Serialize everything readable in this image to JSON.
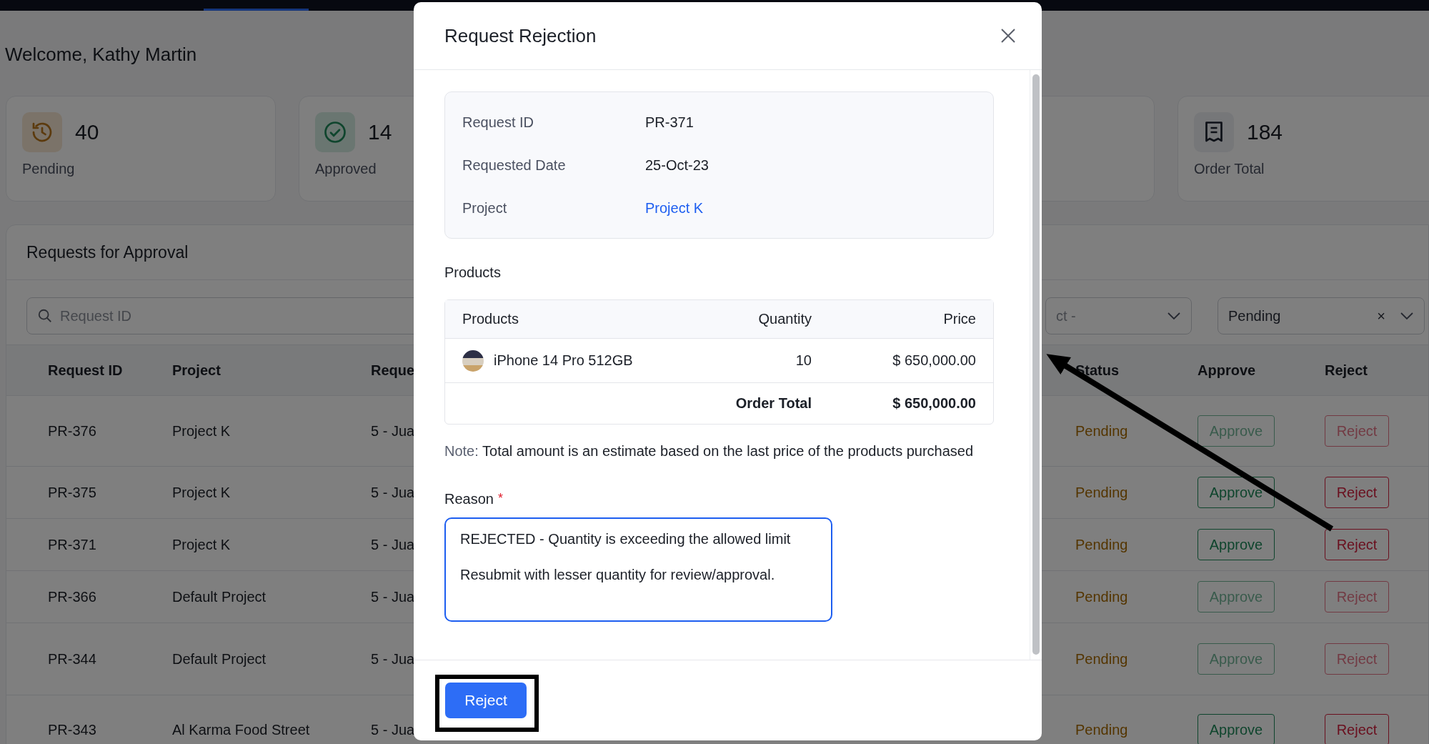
{
  "welcome": "Welcome, Kathy Martin",
  "stat_cards": [
    {
      "kind": "pending",
      "value": "40",
      "label": "Pending"
    },
    {
      "kind": "approved",
      "value": "14",
      "label": "Approved"
    },
    {
      "kind": "order_total",
      "value": "184",
      "label": "Order Total"
    }
  ],
  "approvals": {
    "title": "Requests for Approval",
    "search": {
      "placeholder": "Request ID"
    },
    "project_filter": {
      "value": "ct -"
    },
    "status_filter": {
      "value": "Pending",
      "clear": "×"
    },
    "columns": [
      "Request ID",
      "Project",
      "Reque",
      "Status",
      "Approve",
      "Reject"
    ],
    "rows": [
      {
        "request_id": "PR-376",
        "project": "Project K",
        "date": "5 - Jua",
        "status": "Pending",
        "approve": "Approve",
        "reject": "Reject",
        "disabled": true
      },
      {
        "request_id": "PR-375",
        "project": "Project K",
        "date": "5 - Jua",
        "status": "Pending",
        "approve": "Approve",
        "reject": "Reject",
        "disabled": false
      },
      {
        "request_id": "PR-371",
        "project": "Project K",
        "date": "5 - Jua",
        "status": "Pending",
        "approve": "Approve",
        "reject": "Reject",
        "disabled": false
      },
      {
        "request_id": "PR-366",
        "project": "Default Project",
        "date": "5 - Jua",
        "status": "Pending",
        "approve": "Approve",
        "reject": "Reject",
        "disabled": true
      },
      {
        "request_id": "PR-344",
        "project": "Default Project",
        "date": "5 - Jua",
        "status": "Pending",
        "approve": "Approve",
        "reject": "Reject",
        "disabled": true
      },
      {
        "request_id": "PR-343",
        "project": "Al Karma Food Street",
        "date": "5 - Jua",
        "status": "Pending",
        "approve": "Approve",
        "reject": "Reject",
        "disabled": false
      }
    ]
  },
  "modal": {
    "title": "Request Rejection",
    "details": [
      {
        "kind": "text",
        "label": "Request ID",
        "value": "PR-371"
      },
      {
        "kind": "text",
        "label": "Requested Date",
        "value": "25-Oct-23"
      },
      {
        "kind": "link",
        "label": "Project",
        "value": "Project K"
      }
    ],
    "products_title": "Products",
    "product_columns": [
      "Products",
      "Quantity",
      "Price"
    ],
    "products": [
      {
        "name": "iPhone 14 Pro 512GB",
        "quantity": "10",
        "price": "$ 650,000.00"
      }
    ],
    "total_label": "Order Total",
    "total_value": "$ 650,000.00",
    "note_label": "Note:",
    "note_text": "Total amount is an estimate based on the last price of the products purchased",
    "reason": {
      "label": "Reason",
      "required_mark": "*",
      "value": "REJECTED - Quantity is exceeding the allowed limit\n\nResubmit with lesser quantity for review/approval."
    },
    "submit": "Reject"
  }
}
